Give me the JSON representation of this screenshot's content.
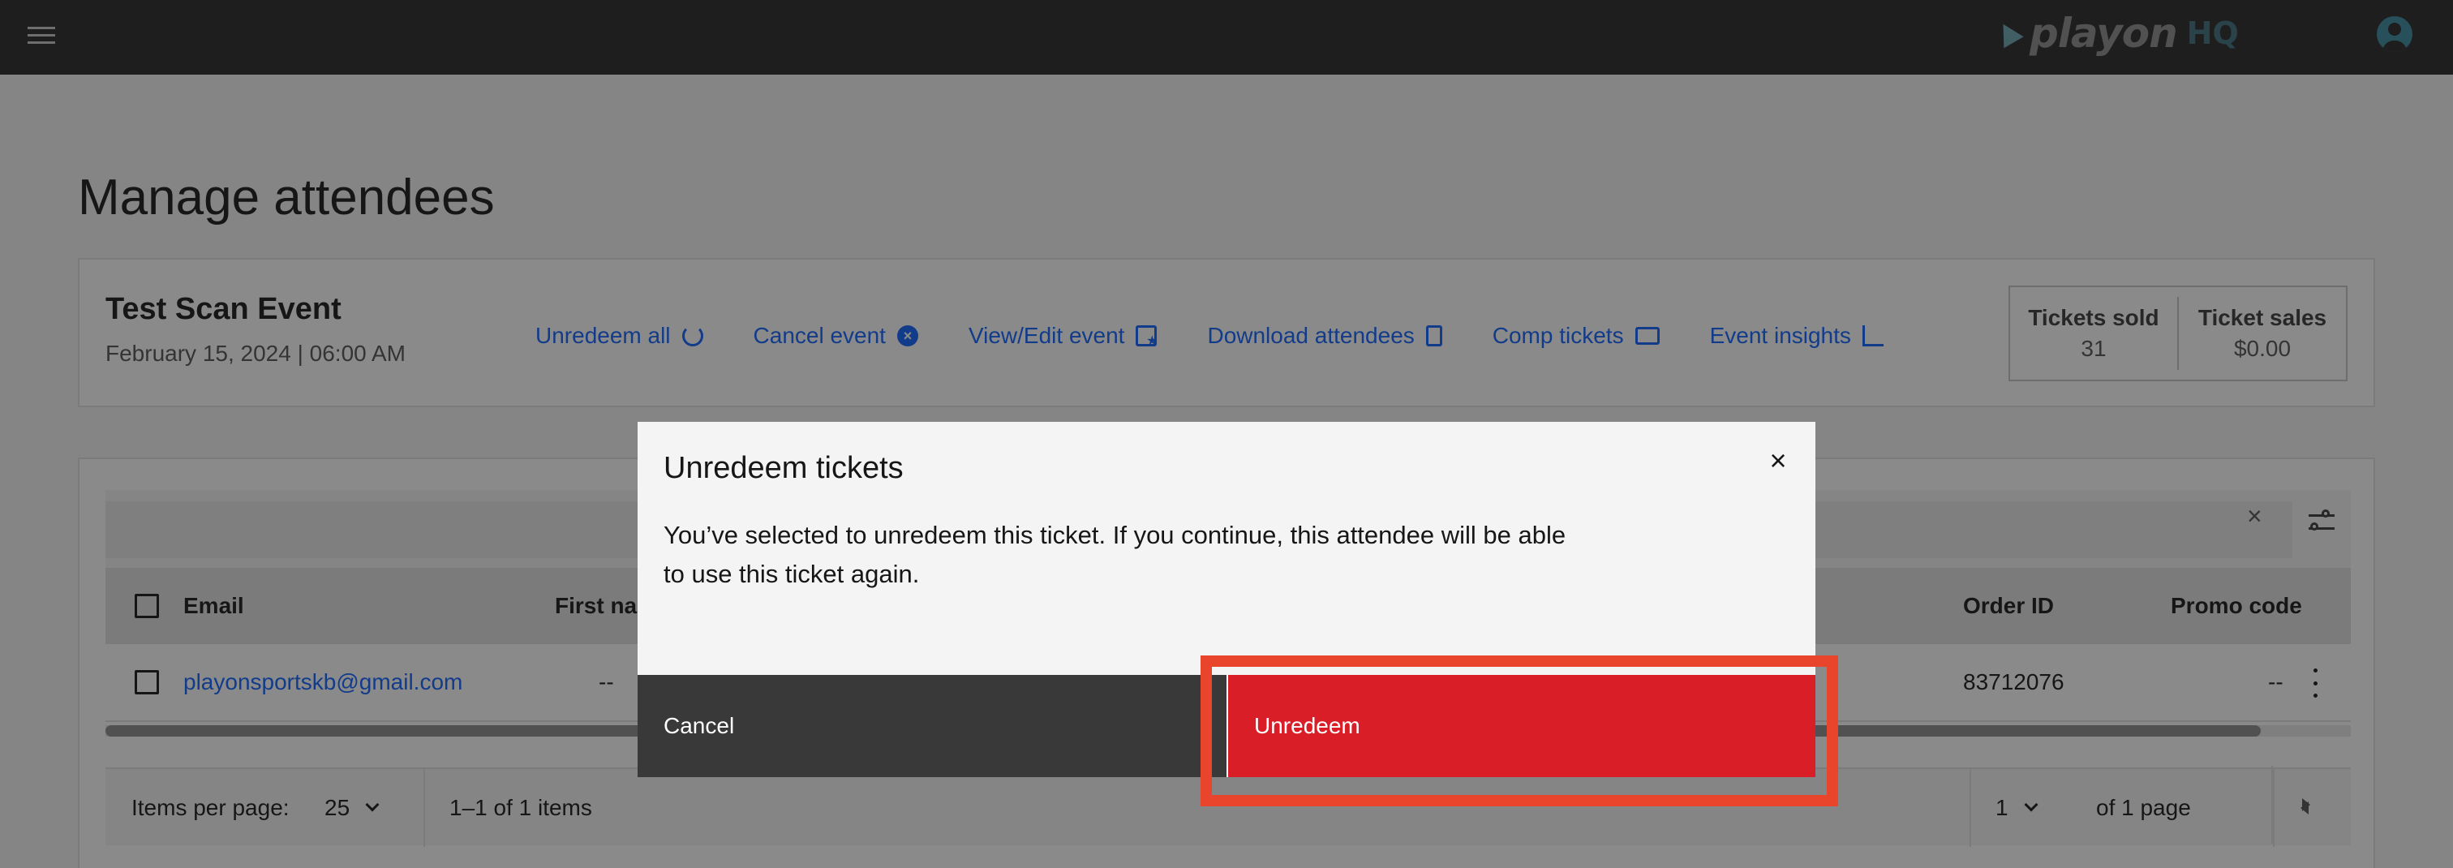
{
  "topbar": {
    "menu_icon": "hamburger-menu-icon",
    "logo_text": "playon",
    "logo_suffix": "HQ",
    "user_icon": "user-avatar-icon"
  },
  "page": {
    "title": "Manage attendees"
  },
  "event": {
    "name": "Test Scan Event",
    "date": "February 15, 2024 | 06:00 AM",
    "actions": [
      {
        "label": "Unredeem all",
        "icon": "undo-icon"
      },
      {
        "label": "Cancel event",
        "icon": "close-circle-icon"
      },
      {
        "label": "View/Edit event",
        "icon": "calendar-star-icon"
      },
      {
        "label": "Download attendees",
        "icon": "clipboard-icon"
      },
      {
        "label": "Comp tickets",
        "icon": "ticket-icon"
      },
      {
        "label": "Event insights",
        "icon": "bar-chart-icon"
      }
    ],
    "stats": {
      "tickets_sold_label": "Tickets sold",
      "tickets_sold_value": "31",
      "ticket_sales_label": "Ticket sales",
      "ticket_sales_value": "$0.00"
    }
  },
  "table": {
    "search_clear": "×",
    "columns": {
      "email": "Email",
      "first_name": "First na",
      "order_id": "Order ID",
      "promo_code": "Promo code"
    },
    "rows": [
      {
        "email": "playonsportskb@gmail.com",
        "first_name": "--",
        "order_id": "83712076",
        "promo_code": "--"
      }
    ],
    "scrollbar_thumb_fraction": 0.96
  },
  "pagination": {
    "items_per_page_label": "Items per page:",
    "items_per_page_value": "25",
    "range_text": "1–1 of 1 items",
    "current_page": "1",
    "of_pages": "of 1 page"
  },
  "modal": {
    "title": "Unredeem tickets",
    "body": "You’ve selected to unredeem this ticket. If you continue, this attendee will be able to use this ticket again.",
    "close_symbol": "×",
    "cancel_label": "Cancel",
    "confirm_label": "Unredeem"
  },
  "colors": {
    "danger": "#da1e28",
    "highlight": "#e8452c",
    "link": "#0f62fe",
    "topbar": "#262626"
  }
}
